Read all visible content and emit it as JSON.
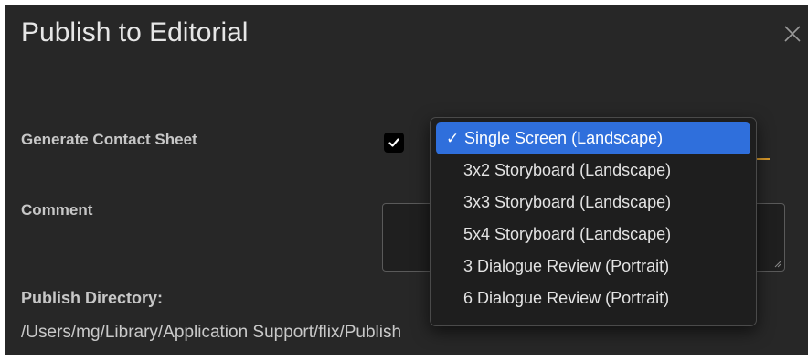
{
  "dialog": {
    "title": "Publish to Editorial",
    "close_icon": "close-icon"
  },
  "form": {
    "contact_sheet_label": "Generate Contact Sheet",
    "contact_sheet_checked": true,
    "comment_label": "Comment",
    "comment_value": "",
    "directory_label": "Publish Directory:",
    "directory_path": "/Users/mg/Library/Application Support/flix/Publish"
  },
  "dropdown": {
    "selected_index": 0,
    "checkmark": "✓",
    "options": [
      "Single Screen (Landscape)",
      "3x2 Storyboard (Landscape)",
      "3x3 Storyboard (Landscape)",
      "5x4 Storyboard (Landscape)",
      "3 Dialogue Review (Portrait)",
      "6 Dialogue Review (Portrait)"
    ]
  },
  "colors": {
    "background": "#272727",
    "selected_item": "#2f6fdc",
    "accent": "#d99a2b"
  }
}
